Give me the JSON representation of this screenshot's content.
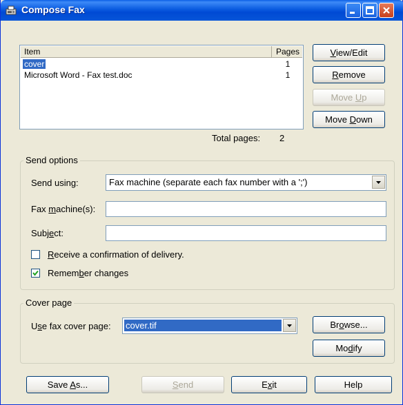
{
  "window": {
    "title": "Compose Fax"
  },
  "list": {
    "columns": {
      "item": "Item",
      "pages": "Pages"
    },
    "rows": [
      {
        "item": "cover",
        "pages": "1",
        "selected": true
      },
      {
        "item": "Microsoft Word - Fax test.doc",
        "pages": "1",
        "selected": false
      }
    ]
  },
  "list_buttons": {
    "view_edit": {
      "pre": "",
      "key": "V",
      "post": "iew/Edit"
    },
    "remove": {
      "pre": "",
      "key": "R",
      "post": "emove"
    },
    "move_up": {
      "pre": "Move ",
      "key": "U",
      "post": "p"
    },
    "move_down": {
      "pre": "Move ",
      "key": "D",
      "post": "own"
    }
  },
  "total_pages": {
    "label": "Total pages:",
    "value": "2"
  },
  "send_options": {
    "title": "Send options",
    "send_using": {
      "pre": "Send using:",
      "value": "Fax machine (separate each fax number with a ';')"
    },
    "fax_machines": {
      "pre": "Fax ",
      "key": "m",
      "post": "achine(s):",
      "value": ""
    },
    "subject": {
      "pre": "Subj",
      "key": "e",
      "post": "ct:",
      "value": ""
    },
    "confirm": {
      "pre": "",
      "key": "R",
      "post": "eceive a confirmation of delivery.",
      "checked": false
    },
    "remember": {
      "pre": "Remem",
      "key": "b",
      "post": "er changes",
      "checked": true
    }
  },
  "cover_page": {
    "title": "Cover page",
    "use_label": {
      "pre": "U",
      "key": "s",
      "post": "e fax cover page:"
    },
    "value": "cover.tif",
    "browse": {
      "pre": "Br",
      "key": "o",
      "post": "wse..."
    },
    "modify": {
      "pre": "Mo",
      "key": "d",
      "post": "ify"
    }
  },
  "footer": {
    "save_as": {
      "pre": "Save ",
      "key": "A",
      "post": "s..."
    },
    "send": {
      "pre": "",
      "key": "S",
      "post": "end"
    },
    "exit": {
      "pre": "E",
      "key": "x",
      "post": "it"
    },
    "help": "Help"
  },
  "colors": {
    "title_bar": "#0a5be0",
    "selection": "#316ac5",
    "dialog": "#ece9d8"
  }
}
